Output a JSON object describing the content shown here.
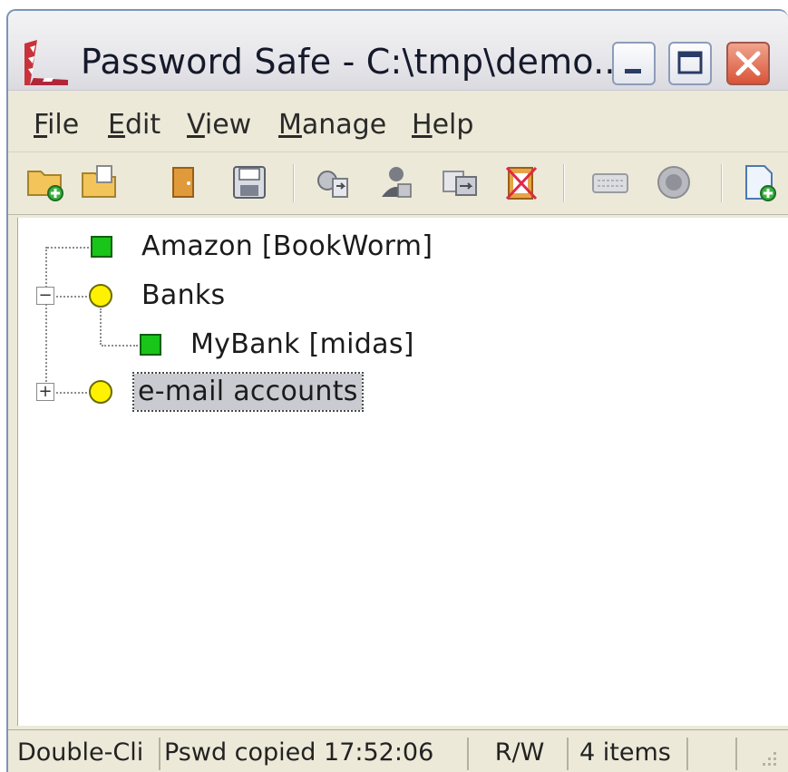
{
  "window": {
    "title": "Password Safe - C:\\tmp\\demo..."
  },
  "menubar": {
    "items": [
      {
        "mnemonic": "F",
        "rest": "ile"
      },
      {
        "mnemonic": "E",
        "rest": "dit"
      },
      {
        "mnemonic": "V",
        "rest": "iew"
      },
      {
        "mnemonic": "M",
        "rest": "anage"
      },
      {
        "mnemonic": "H",
        "rest": "elp"
      }
    ]
  },
  "toolbar": {
    "icons": [
      "new-database-icon",
      "open-database-icon",
      "close-database-icon",
      "save-icon",
      "copy-password-icon",
      "copy-username-icon",
      "copy-notes-icon",
      "clear-clipboard-icon",
      "autotype-icon",
      "browse-url-icon",
      "add-entry-icon"
    ]
  },
  "tree": {
    "nodes": [
      {
        "label": "Amazon [BookWorm]",
        "type": "entry"
      },
      {
        "label": "Banks",
        "type": "group",
        "expanded": true
      },
      {
        "label": "MyBank [midas]",
        "type": "entry"
      },
      {
        "label": "e-mail accounts",
        "type": "group",
        "expanded": false,
        "selected": true
      }
    ]
  },
  "statusbar": {
    "hint": "Double-Cli",
    "message": "Pswd copied 17:52:06",
    "mode": "R/W",
    "count": "4 items"
  },
  "colors": {
    "entry": "#18c518",
    "group": "#fff200",
    "selection": "#c9cbd0"
  }
}
